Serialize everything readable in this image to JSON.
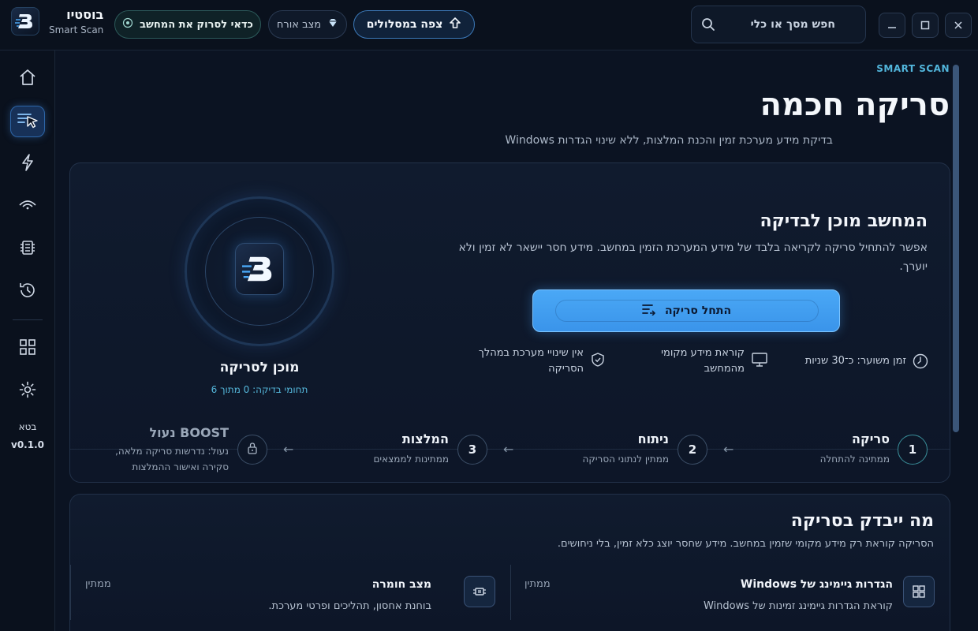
{
  "app": {
    "name": "בוסטיו",
    "subtitle": "Smart Scan"
  },
  "topbar": {
    "worth_scan_label": "כדאי לסרוק את המחשב",
    "guest_mode_label": "מצב אורח",
    "watch_plans_label": "צפה במסלולים",
    "search_placeholder": "חפש מסך או כלי"
  },
  "window_controls": {
    "minimize": "—",
    "maximize": "☐",
    "close": "✕"
  },
  "rail": {
    "items": [
      "home-icon",
      "smart-scan-icon",
      "bolt-icon",
      "network-icon",
      "chip-icon",
      "history-icon",
      "grid-icon",
      "settings-icon"
    ],
    "beta_label": "בטא",
    "version": "v0.1.0"
  },
  "page": {
    "eyebrow": "SMART SCAN",
    "title": "סריקה חכמה",
    "subtitle": "בדיקת מידע מערכת זמין והכנת המלצות, ללא שינוי הגדרות Windows"
  },
  "ready_card": {
    "title": "המחשב מוכן לבדיקה",
    "description": "אפשר להתחיל סריקה לקריאה בלבד של מידע המערכת הזמין במחשב. מידע חסר יישאר לא זמין ולא יוערך.",
    "start_button": "התחל סריקה",
    "features": [
      {
        "icon": "clock-icon",
        "text": "זמן משוער: כ־30 שניות"
      },
      {
        "icon": "monitor-icon",
        "text": "קוראת מידע מקומי מהמחשב"
      },
      {
        "icon": "shield-check-icon",
        "text": "אין שינויי מערכת במהלך הסריקה"
      }
    ],
    "status_label": "מוכן לסריקה",
    "status_count": "תחומי בדיקה: 0 מתוך 6"
  },
  "steps": [
    {
      "num": "1",
      "title": "סריקה",
      "desc": "ממתינה להתחלה"
    },
    {
      "num": "2",
      "title": "ניתוח",
      "desc": "ממתין לנתוני הסריקה"
    },
    {
      "num": "3",
      "title": "המלצות",
      "desc": "ממתינות לממצאים"
    },
    {
      "title": "BOOST נעול",
      "desc_line1": "נעול: נדרשות סריקה מלאה,",
      "desc_line2": "סקירה ואישור ההמלצות"
    }
  ],
  "step_arrow": "←",
  "checks": {
    "title": "מה ייבדק בסריקה",
    "subtitle": "הסריקה קוראת רק מידע מקומי שזמין במחשב. מידע שחסר יוצג כלא זמין, בלי ניחושים.",
    "items": [
      {
        "title": "הגדרות גיימינג של Windows",
        "desc": "קוראת הגדרות גיימינג זמינות של Windows",
        "status": "ממתין",
        "icon": "windows-grid-icon"
      },
      {
        "title": "מצב חומרה",
        "desc": "בוחנת אחסון, תהליכים ופרטי מערכת.",
        "status": "ממתין",
        "icon": "chip-icon"
      }
    ]
  },
  "colors": {
    "accent": "#4aa8f6",
    "teal": "#55b8dc",
    "background": "#0b1322"
  }
}
